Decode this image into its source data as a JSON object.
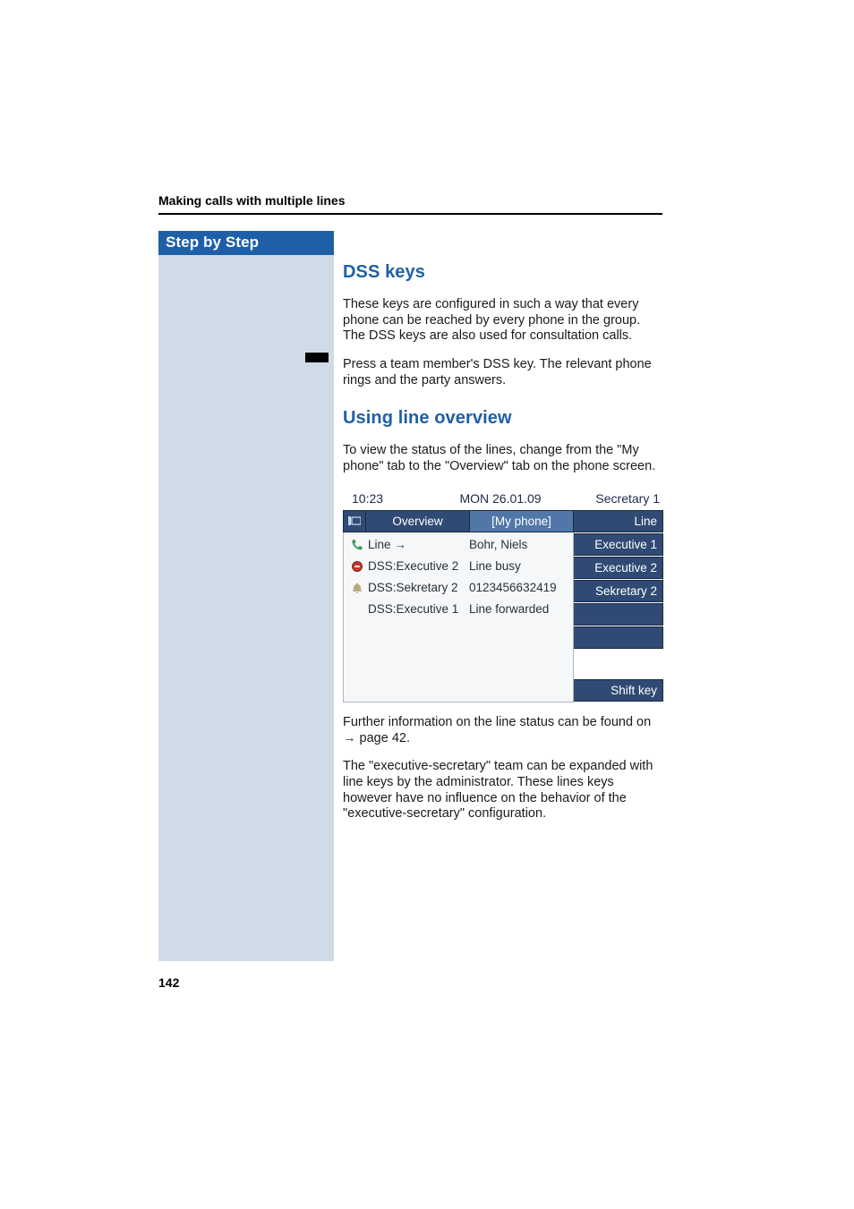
{
  "running_header": "Making calls with multiple lines",
  "sidebar": {
    "title": "Step by Step"
  },
  "section1": {
    "heading": "DSS keys",
    "para1": "These keys are configured in such a way that every phone can be reached by every phone in the group. The DSS keys are also used for consultation calls.",
    "para2": "Press a team member's DSS key. The relevant phone rings and the party answers."
  },
  "section2": {
    "heading": "Using line overview",
    "para1": "To view the status of the lines, change from the \"My phone\" tab to the \"Overview\" tab on the phone screen.",
    "para_after1": "Further information on the line status can be found on → page 42.",
    "para_after2": "The \"executive-secretary\" team can be expanded with line keys by the administrator. These lines keys however have no influence on the behavior of the \"executive-secretary\" configuration."
  },
  "phone": {
    "time": "10:23",
    "date": "MON 26.01.09",
    "user": "Secretary 1",
    "corner_icon": "phone-display-icon",
    "tabs": [
      {
        "label": "Overview",
        "active": false
      },
      {
        "label": "[My phone]",
        "active": true
      }
    ],
    "rows": [
      {
        "icon": "handset-icon",
        "label": "Line →",
        "value": "Bohr, Niels"
      },
      {
        "icon": "busy-dot-icon",
        "label": "DSS:Executive 2",
        "value": "Line busy"
      },
      {
        "icon": "bell-icon",
        "label": "DSS:Sekretary 2",
        "value": "0123456632419"
      },
      {
        "icon": "",
        "label": "DSS:Executive 1",
        "value": "Line forwarded"
      }
    ],
    "side_buttons_top": [
      "Line",
      "Executive 1",
      "Executive 2",
      "Sekretary 2",
      "",
      ""
    ],
    "side_button_bottom": "Shift key"
  },
  "page_number": "142"
}
